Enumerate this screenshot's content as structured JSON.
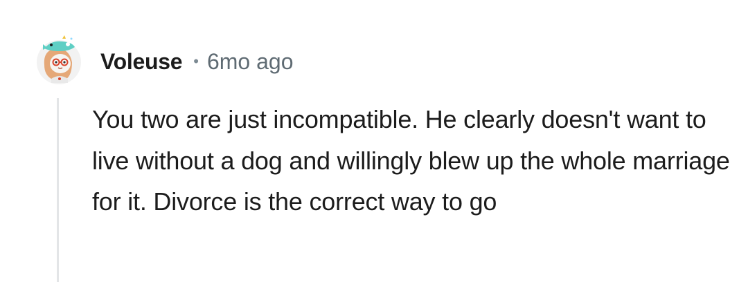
{
  "comment": {
    "author": "Voleuse",
    "separator": "•",
    "timestamp": "6mo ago",
    "body": "You two are just incompatible. He clearly doesn't want to live without a dog and willingly blew up the whole marriage for it. Divorce is the correct way to go"
  },
  "avatar": {
    "icon": "snoo-avatar-icon",
    "colors": {
      "hat": "#5fcfc4",
      "hair": "#e5a878",
      "glasses": "#d9432b",
      "skin": "#f3f1ee"
    }
  },
  "colors": {
    "username": "#1c1c1c",
    "meta": "#5f6b73",
    "thread_line": "#e3e5e7",
    "text": "#1c1c1c"
  }
}
